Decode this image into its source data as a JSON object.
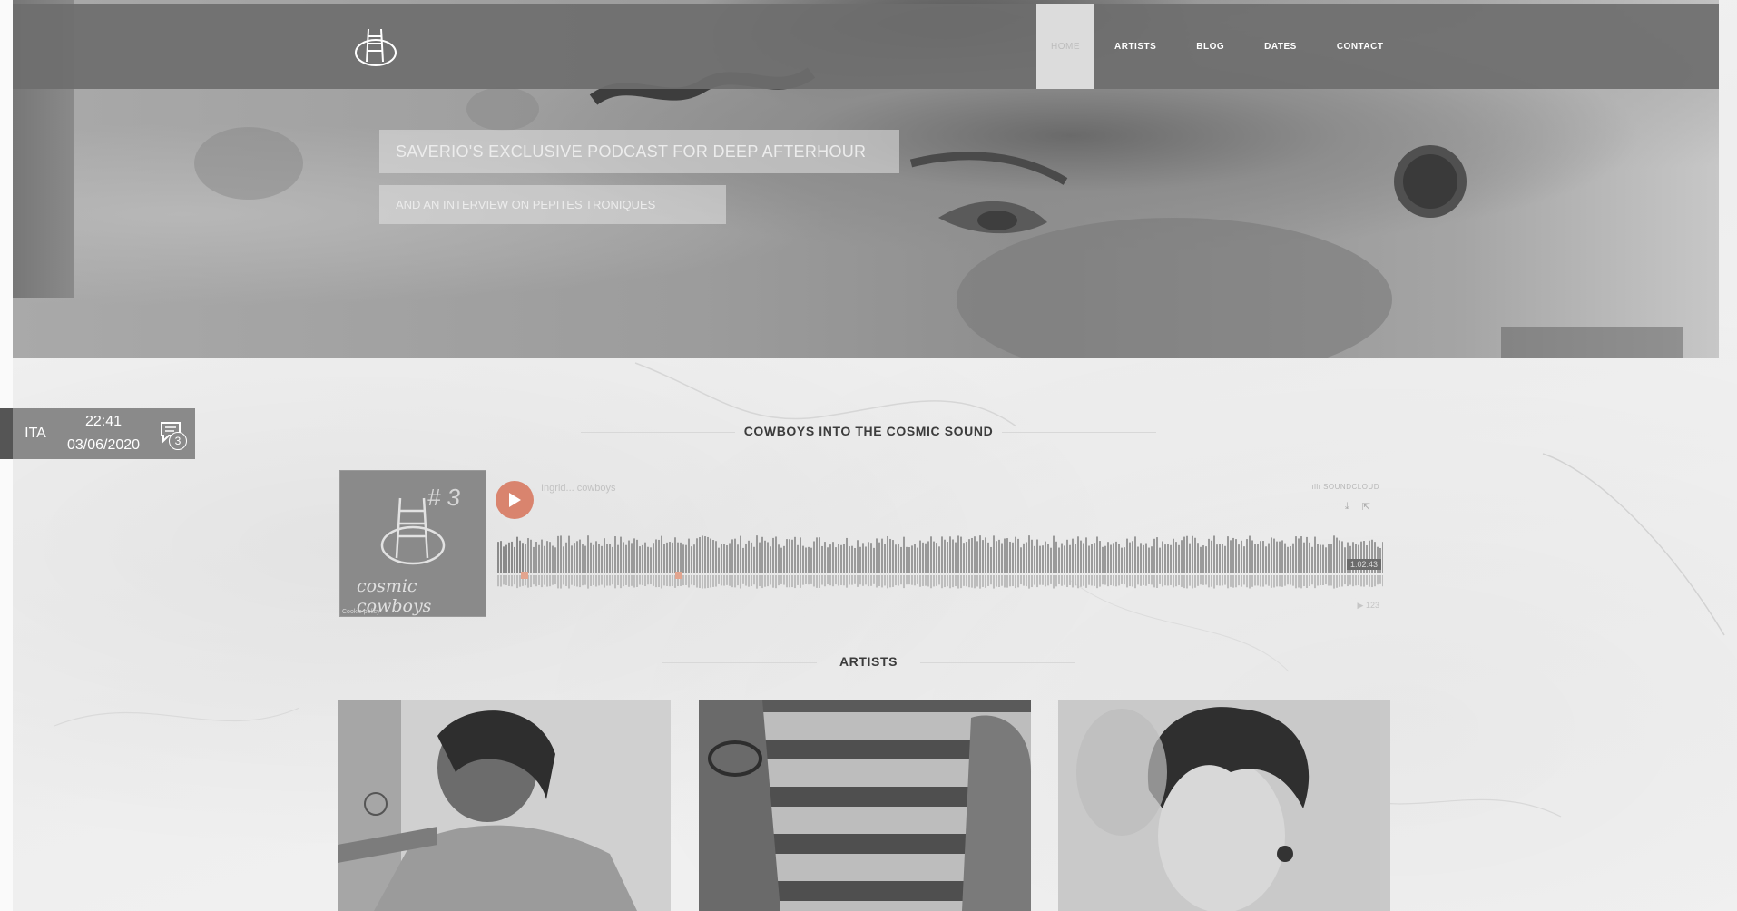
{
  "nav": {
    "items": [
      {
        "label": "HOME",
        "active": true
      },
      {
        "label": "ARTISTS",
        "active": false
      },
      {
        "label": "BLOG",
        "active": false
      },
      {
        "label": "DATES",
        "active": false
      },
      {
        "label": "CONTACT",
        "active": false
      }
    ]
  },
  "hero": {
    "headline": "SAVERIO'S EXCLUSIVE PODCAST FOR DEEP AFTERHOUR",
    "subline": "AND AN INTERVIEW ON PEPITES TRONIQUES"
  },
  "clock_widget": {
    "language": "ITA",
    "time": "22:41",
    "date": "03/06/2020",
    "notification_count": "3"
  },
  "podcast": {
    "section_title": "COWBOYS INTO THE COSMIC SOUND",
    "cover_number": "# 3",
    "cover_script": "cosmic cowboys",
    "cover_caption": "Cookie policy",
    "track_title": "Ingrid... cowboys",
    "source_label": "SOUNDCLOUD",
    "duration": "1:02:43",
    "plays": "▶ 123"
  },
  "artists_section": {
    "title": "ARTISTS"
  },
  "colors": {
    "nav_bg": "#6e6e6e",
    "play_button": "#d9846e",
    "page_bg": "#f3f3f3"
  }
}
